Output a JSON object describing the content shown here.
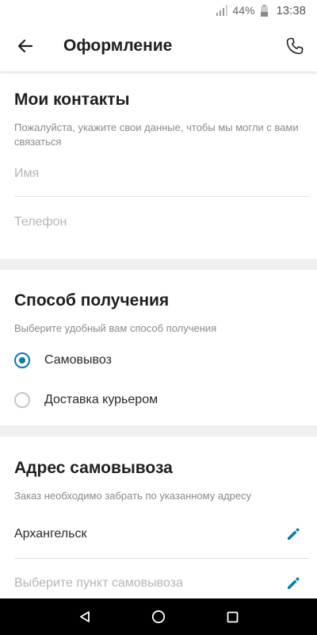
{
  "status_bar": {
    "battery_percent": "44%",
    "time": "13:38"
  },
  "app_bar": {
    "title": "Оформление",
    "back_icon": "arrow-back-icon",
    "call_icon": "phone-icon"
  },
  "contacts": {
    "title": "Мои контакты",
    "subtitle": "Пожалуйста, укажите свои данные, чтобы мы могли с вами связаться",
    "name_placeholder": "Имя",
    "phone_placeholder": "Телефон"
  },
  "delivery": {
    "title": "Способ получения",
    "subtitle": "Выберите удобный вам способ получения",
    "options": [
      {
        "label": "Самовывоз",
        "selected": true
      },
      {
        "label": "Доставка курьером",
        "selected": false
      }
    ]
  },
  "pickup": {
    "title": "Адрес самовывоза",
    "subtitle": "Заказ необходимо забрать по указанному адресу",
    "city": "Архангельск",
    "point_placeholder": "Выберите пункт самовывоза",
    "edit_icon": "pencil-icon"
  },
  "colors": {
    "accent": "#0a7aa8",
    "divider_band": "#f0f0f0",
    "placeholder": "#b5b5b5"
  },
  "nav_bar": {
    "icons": [
      "nav-back-icon",
      "nav-home-icon",
      "nav-recents-icon"
    ]
  }
}
